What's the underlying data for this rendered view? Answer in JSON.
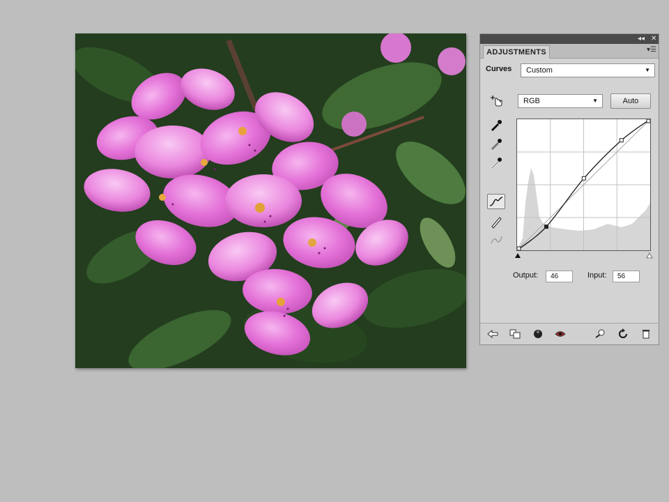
{
  "photo": {
    "subject": "pink rhododendron flowers"
  },
  "panel": {
    "title_controls": {
      "collapse": "◂◂",
      "close": "✕"
    },
    "tab_label": "ADJUSTMENTS",
    "menu_icon": "panel-menu-icon",
    "adjustment_name": "Curves",
    "preset": {
      "value": "Custom"
    },
    "channel": {
      "value": "RGB"
    },
    "auto_button": "Auto",
    "output": {
      "label": "Output:",
      "value": "46"
    },
    "input": {
      "label": "Input:",
      "value": "56"
    },
    "curve_points": [
      {
        "input": 0,
        "output": 0
      },
      {
        "input": 56,
        "output": 46
      },
      {
        "input": 128,
        "output": 140
      },
      {
        "input": 200,
        "output": 214
      },
      {
        "input": 255,
        "output": 255
      }
    ],
    "colors": {
      "panel_bg": "#d3d3d3",
      "titlebar": "#4a4a4a",
      "curve": "#222222",
      "histogram": "#d6d6d6"
    }
  }
}
